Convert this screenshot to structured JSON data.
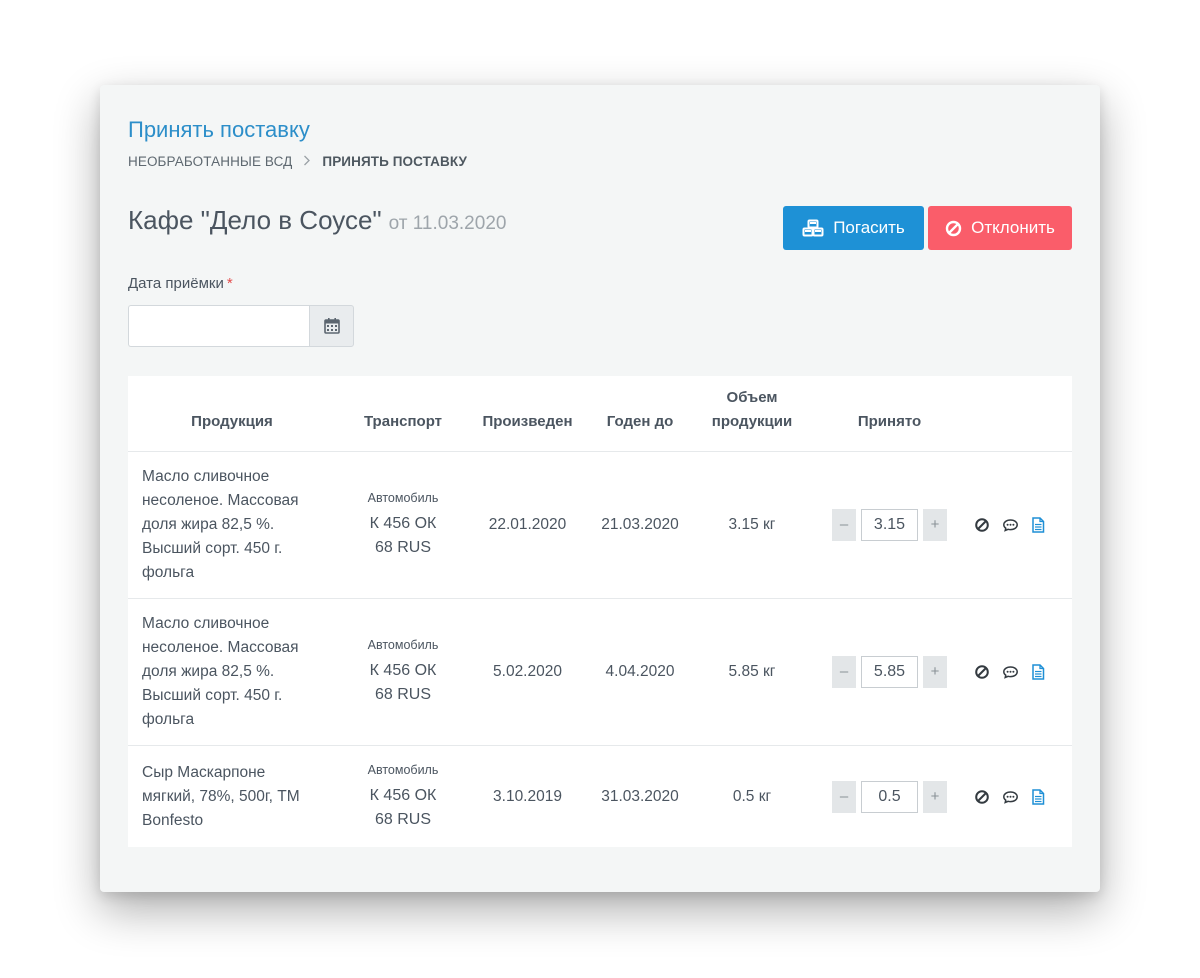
{
  "page": {
    "title": "Принять поставку",
    "breadcrumb": {
      "parent": "НЕОБРАБОТАННЫЕ ВСД",
      "separator": ">",
      "current": "ПРИНЯТЬ ПОСТАВКУ"
    },
    "org_name": "Кафе \"Дело в Соусе\"",
    "org_date": "от 11.03.2020"
  },
  "actions": {
    "accept_label": "Погасить",
    "reject_label": "Отклонить",
    "accept_icon": "cubes-icon",
    "reject_icon": "ban-icon",
    "accept_color": "#1e91d6",
    "reject_color": "#fa5d6a"
  },
  "form": {
    "date_label": "Дата приёмки",
    "required_mark": "*",
    "date_value": "",
    "date_placeholder": "",
    "calendar_icon": "calendar-icon"
  },
  "table": {
    "headers": {
      "product": "Продукция",
      "transport": "Транспорт",
      "produced": "Произведен",
      "expires": "Годен до",
      "volume_line1": "Объем",
      "volume_line2": "продукции",
      "accepted": "Принято"
    },
    "rows": [
      {
        "product": "Масло сливочное несоленое. Массовая доля жира 82,5 %. Высший сорт. 450 г. фольга",
        "transport_type": "Автомобиль",
        "plate_line1": "К 456 ОК",
        "plate_line2": "68 RUS",
        "produced": "22.01.2020",
        "expires": "21.03.2020",
        "volume": "3.15 кг",
        "accepted": "3.15"
      },
      {
        "product": "Масло сливочное несоленое. Массовая доля жира 82,5 %. Высший сорт. 450 г. фольга",
        "transport_type": "Автомобиль",
        "plate_line1": "К 456 ОК",
        "plate_line2": "68 RUS",
        "produced": "5.02.2020",
        "expires": "4.04.2020",
        "volume": "5.85 кг",
        "accepted": "5.85"
      },
      {
        "product": "Сыр Маскарпоне мягкий, 78%, 500г, ТМ Bonfesto",
        "transport_type": "Автомобиль",
        "plate_line1": "К 456 ОК",
        "plate_line2": "68 RUS",
        "produced": "3.10.2019",
        "expires": "31.03.2020",
        "volume": "0.5 кг",
        "accepted": "0.5"
      }
    ],
    "stepper": {
      "minus": "–",
      "plus": "+"
    },
    "row_icons": [
      "ban-icon",
      "comment-icon",
      "document-icon"
    ]
  }
}
